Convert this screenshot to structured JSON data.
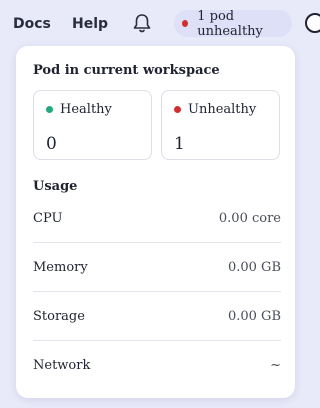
{
  "topbar": {
    "docs_label": "Docs",
    "help_label": "Help",
    "status_text": "1 pod unhealthy"
  },
  "panel": {
    "title": "Pod in current workspace",
    "healthy": {
      "label": "Healthy",
      "value": "0"
    },
    "unhealthy": {
      "label": "Unhealthy",
      "value": "1"
    },
    "usage_title": "Usage",
    "metrics": [
      {
        "label": "CPU",
        "value": "0.00 core"
      },
      {
        "label": "Memory",
        "value": "0.00 GB"
      },
      {
        "label": "Storage",
        "value": "0.00 GB"
      },
      {
        "label": "Network",
        "value": "~"
      }
    ]
  },
  "colors": {
    "healthy": "#22a87a",
    "unhealthy": "#d12f2f",
    "background": "#e8eaf9"
  },
  "icons": {
    "bell": "bell-icon",
    "status_dot": "red-dot"
  }
}
